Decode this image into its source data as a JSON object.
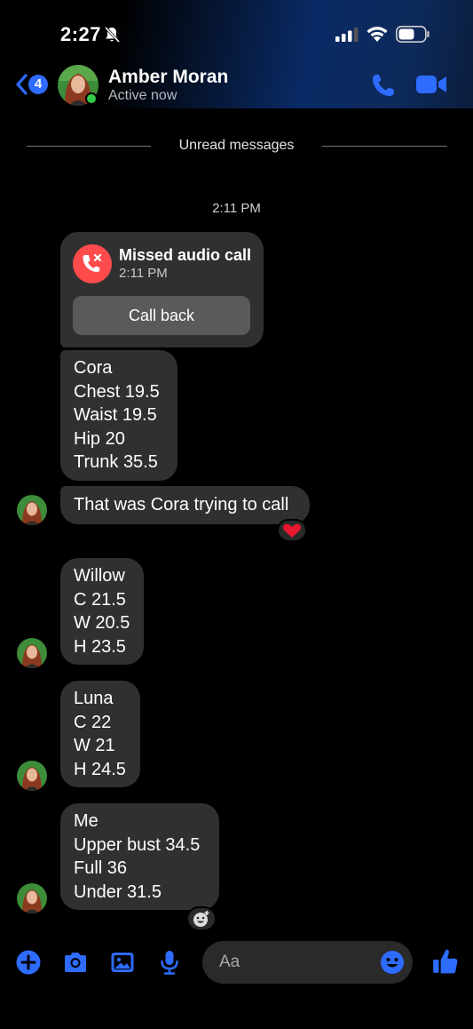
{
  "status_bar": {
    "time": "2:27"
  },
  "header": {
    "back_count": "4",
    "contact_name": "Amber Moran",
    "contact_status": "Active now"
  },
  "divider": {
    "label": "Unread messages"
  },
  "timestamp": "2:11 PM",
  "missed_call": {
    "title": "Missed audio call",
    "time": "2:11 PM",
    "button": "Call back"
  },
  "messages": [
    {
      "lines": [
        "Cora",
        "Chest 19.5",
        "Waist 19.5",
        "Hip 20",
        "Trunk 35.5"
      ]
    },
    {
      "lines": [
        "That was Cora trying to call"
      ],
      "reaction": "heart"
    },
    {
      "lines": [
        "Willow",
        "C 21.5",
        "W 20.5",
        "H 23.5"
      ]
    },
    {
      "lines": [
        "Luna",
        "C 22",
        "W 21",
        "H 24.5"
      ]
    },
    {
      "lines": [
        "Me",
        "Upper bust 34.5",
        "Full 36",
        "Under 31.5"
      ]
    }
  ],
  "composer": {
    "placeholder": "Aa"
  },
  "colors": {
    "accent": "#2e6bff",
    "bubble": "#303030",
    "missed": "#ff4b4b",
    "online": "#31cc46"
  }
}
